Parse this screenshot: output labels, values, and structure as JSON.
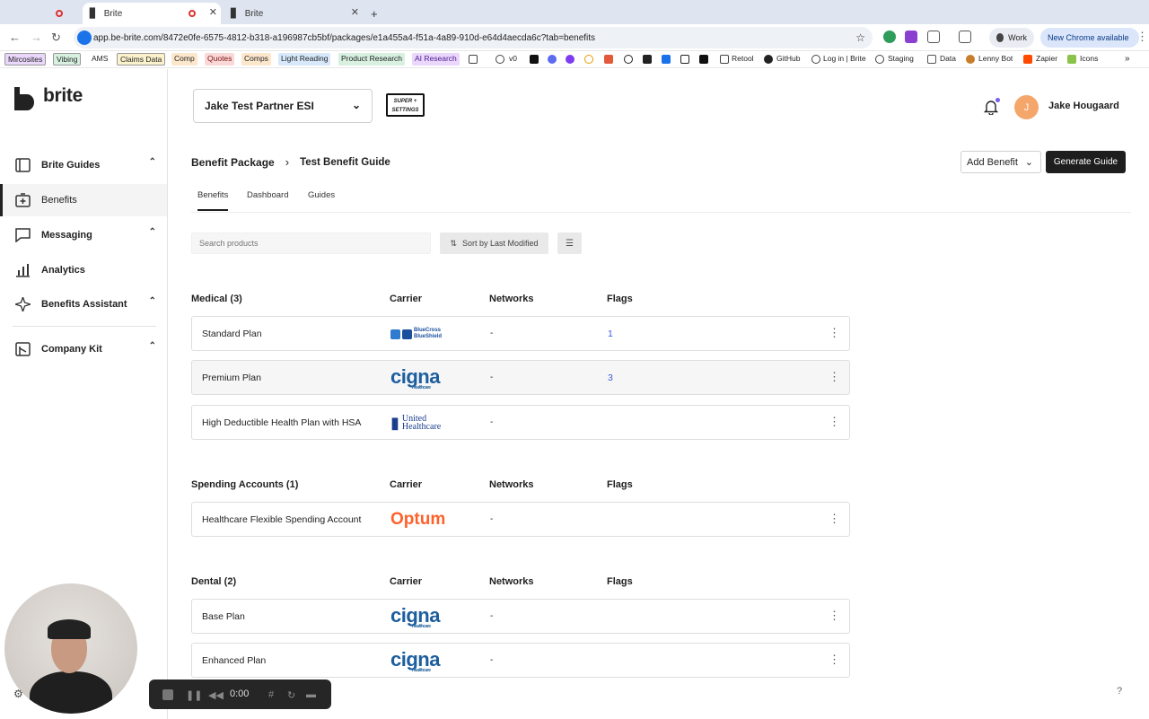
{
  "browser": {
    "tabs": [
      {
        "label": ""
      },
      {
        "label": "Brite"
      },
      {
        "label": "Brite"
      }
    ],
    "url": "app.be-brite.com/8472e0fe-6575-4812-b318-a196987cb5bf/packages/e1a455a4-f51a-4a89-910d-e64d4aecda6c?tab=benefits",
    "profile_label": "Work",
    "update_label": "New Chrome available",
    "bookmarks_tagged": [
      "Mircosites",
      "Vibing",
      "AMS",
      "Claims Data",
      "Comp",
      "Quotes",
      "Comps",
      "Light Reading",
      "Product Research",
      "AI Research"
    ],
    "bookmarks_plain": [
      "v0",
      "Retool",
      "GitHub",
      "Log in | Brite",
      "Staging",
      "Data",
      "Lenny Bot",
      "Zapier",
      "Icons"
    ],
    "colors": {
      "tab_bar": "#dfe5f0",
      "accent": "#1a73e8"
    }
  },
  "sidebar": {
    "brand": "brite",
    "items": [
      {
        "label": "Brite Guides",
        "icon": "guides-icon",
        "expandable": true
      },
      {
        "label": "Benefits",
        "icon": "benefits-icon",
        "expandable": false,
        "active": true
      },
      {
        "label": "Messaging",
        "icon": "messaging-icon",
        "expandable": true
      },
      {
        "label": "Analytics",
        "icon": "analytics-icon",
        "expandable": false
      },
      {
        "label": "Benefits Assistant",
        "icon": "sparkle-icon",
        "expandable": true
      },
      {
        "label": "Company Kit",
        "icon": "company-kit-icon",
        "expandable": true
      }
    ]
  },
  "header": {
    "company": "Jake Test Partner ESI",
    "super_badge_line1": "SUPER +",
    "super_badge_line2": "SETTINGS",
    "avatar_initial": "J",
    "user_name": "Jake Hougaard"
  },
  "page": {
    "breadcrumb_root": "Benefit Package",
    "breadcrumb_current": "Test Benefit Guide",
    "add_benefit": "Add Benefit",
    "generate_guide": "Generate Guide",
    "tabs": [
      "Benefits",
      "Dashboard",
      "Guides"
    ],
    "search_placeholder": "Search products",
    "sort_label": "Sort by Last Modified"
  },
  "columns": {
    "carrier": "Carrier",
    "networks": "Networks",
    "flags": "Flags"
  },
  "sections": [
    {
      "title": "Medical (3)",
      "rows": [
        {
          "name": "Standard Plan",
          "carrier": "BlueCross BlueShield",
          "networks": "-",
          "flags": "1"
        },
        {
          "name": "Premium Plan",
          "carrier": "Cigna",
          "networks": "-",
          "flags": "3"
        },
        {
          "name": "High Deductible Health Plan with HSA",
          "carrier": "United Healthcare",
          "networks": "-",
          "flags": ""
        }
      ]
    },
    {
      "title": "Spending Accounts (1)",
      "rows": [
        {
          "name": "Healthcare Flexible Spending Account",
          "carrier": "Optum",
          "networks": "-",
          "flags": ""
        }
      ]
    },
    {
      "title": "Dental (2)",
      "rows": [
        {
          "name": "Base Plan",
          "carrier": "Cigna",
          "networks": "-",
          "flags": ""
        },
        {
          "name": "Enhanced Plan",
          "carrier": "Cigna",
          "networks": "-",
          "flags": ""
        }
      ]
    }
  ],
  "carrier_logos": {
    "bcbs_line1": "BlueCross",
    "bcbs_line2": "BlueShield",
    "cigna": "cigna",
    "cigna_sub": "Healthcare",
    "uhc_line1": "United",
    "uhc_line2": "Healthcare",
    "optum": "Optum"
  },
  "recorder": {
    "time": "0:00"
  },
  "help": "?"
}
